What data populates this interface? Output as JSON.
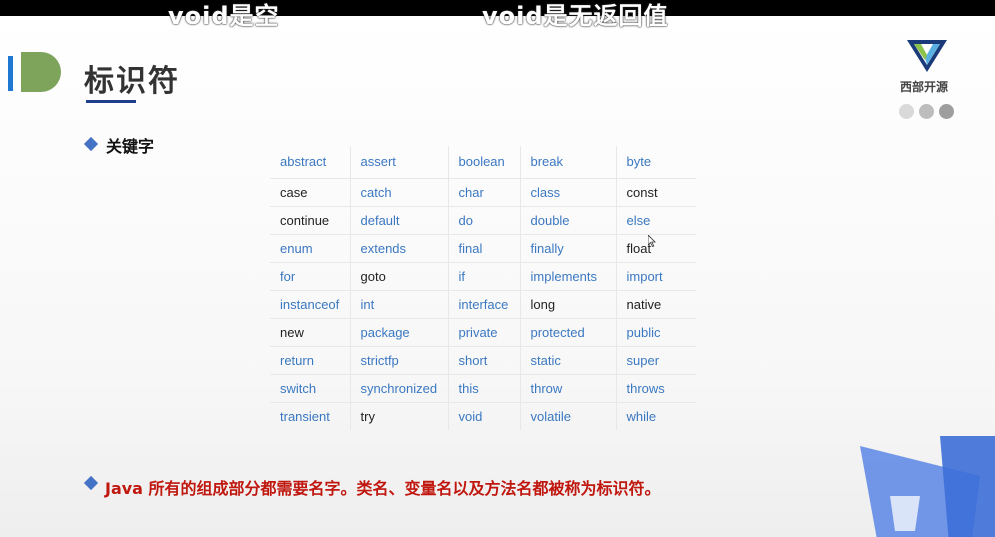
{
  "subtitles": {
    "left": "void是空",
    "right": "void是无返回值"
  },
  "slide": {
    "title": "标识符",
    "section1": "关键字",
    "section2": "Java 所有的组成部分都需要名字。类名、变量名以及方法名都被称为标识符。"
  },
  "brand": {
    "name": "西部开源",
    "logo_icon": "triangle-v-logo-icon",
    "dot_colors": [
      "#d9d9d9",
      "#bdbdbd",
      "#9e9e9e"
    ]
  },
  "colors": {
    "keyword_blue": "#3b78c2",
    "keyword_black": "#222222",
    "title_underline": "#1f3f8c",
    "section2_red": "#c0170f"
  },
  "keywords": [
    [
      {
        "t": "abstract",
        "c": "b"
      },
      {
        "t": "assert",
        "c": "b"
      },
      {
        "t": "boolean",
        "c": "b"
      },
      {
        "t": "break",
        "c": "b"
      },
      {
        "t": "byte",
        "c": "b"
      }
    ],
    [
      {
        "t": "case",
        "c": "k"
      },
      {
        "t": "catch",
        "c": "b"
      },
      {
        "t": "char",
        "c": "b"
      },
      {
        "t": "class",
        "c": "b"
      },
      {
        "t": "const",
        "c": "k"
      }
    ],
    [
      {
        "t": "continue",
        "c": "k"
      },
      {
        "t": "default",
        "c": "b"
      },
      {
        "t": "do",
        "c": "b"
      },
      {
        "t": "double",
        "c": "b"
      },
      {
        "t": "else",
        "c": "b"
      }
    ],
    [
      {
        "t": "enum",
        "c": "b"
      },
      {
        "t": "extends",
        "c": "b"
      },
      {
        "t": "final",
        "c": "b"
      },
      {
        "t": "finally",
        "c": "b"
      },
      {
        "t": "float",
        "c": "k"
      }
    ],
    [
      {
        "t": "for",
        "c": "b"
      },
      {
        "t": "goto",
        "c": "k"
      },
      {
        "t": "if",
        "c": "b"
      },
      {
        "t": "implements",
        "c": "b"
      },
      {
        "t": "import",
        "c": "b"
      }
    ],
    [
      {
        "t": "instanceof",
        "c": "b"
      },
      {
        "t": "int",
        "c": "b"
      },
      {
        "t": "interface",
        "c": "b"
      },
      {
        "t": "long",
        "c": "k"
      },
      {
        "t": "native",
        "c": "k"
      }
    ],
    [
      {
        "t": "new",
        "c": "k"
      },
      {
        "t": "package",
        "c": "b"
      },
      {
        "t": "private",
        "c": "b"
      },
      {
        "t": "protected",
        "c": "b"
      },
      {
        "t": "public",
        "c": "b"
      }
    ],
    [
      {
        "t": "return",
        "c": "b"
      },
      {
        "t": "strictfp",
        "c": "b"
      },
      {
        "t": "short",
        "c": "b"
      },
      {
        "t": "static",
        "c": "b"
      },
      {
        "t": "super",
        "c": "b"
      }
    ],
    [
      {
        "t": "switch",
        "c": "b"
      },
      {
        "t": "synchronized",
        "c": "b"
      },
      {
        "t": "this",
        "c": "b"
      },
      {
        "t": "throw",
        "c": "b"
      },
      {
        "t": "throws",
        "c": "b"
      }
    ],
    [
      {
        "t": "transient",
        "c": "b"
      },
      {
        "t": "try",
        "c": "k"
      },
      {
        "t": "void",
        "c": "b"
      },
      {
        "t": "volatile",
        "c": "b"
      },
      {
        "t": "while",
        "c": "b"
      }
    ]
  ]
}
